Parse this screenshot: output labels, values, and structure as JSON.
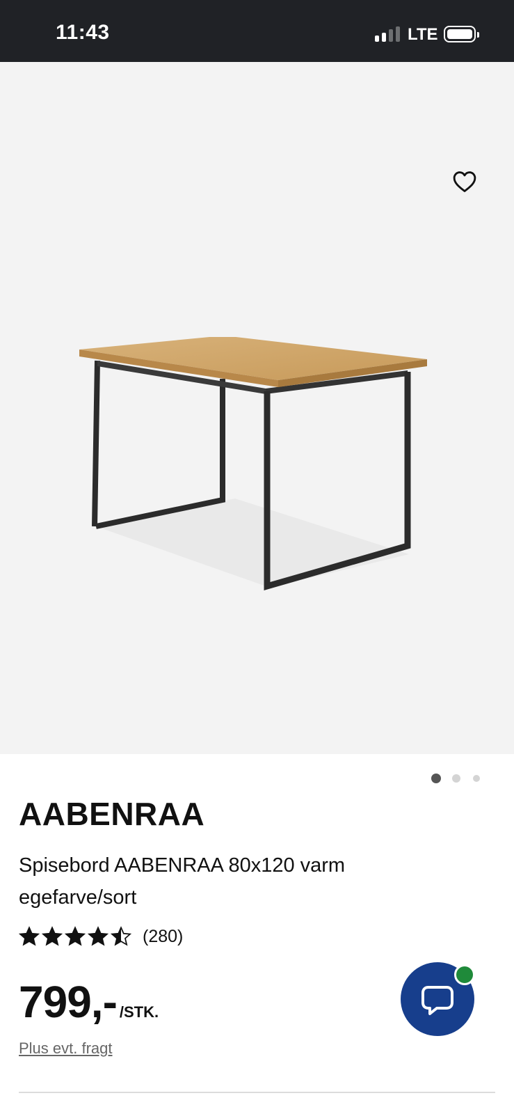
{
  "status_bar": {
    "time": "11:43",
    "network": "LTE",
    "signal_bars_active": 2,
    "signal_bars_total": 4
  },
  "gallery": {
    "favorite_icon": "heart-outline-icon",
    "image_alt": "Spisebord AABENRAA",
    "active_dot": 1,
    "dot_count": 3
  },
  "product": {
    "brand": "AABENRAA",
    "description": "Spisebord AABENRAA 80x120 varm egefarve/sort",
    "rating_value": 4.5,
    "rating_max": 5,
    "review_count": "(280)",
    "price": "799,-",
    "price_unit": "/STK.",
    "freight_link": "Plus evt. fragt"
  },
  "chat": {
    "icon": "chat-bubble-icon",
    "online_color": "#1f8a3a",
    "button_color": "#173e8c"
  }
}
